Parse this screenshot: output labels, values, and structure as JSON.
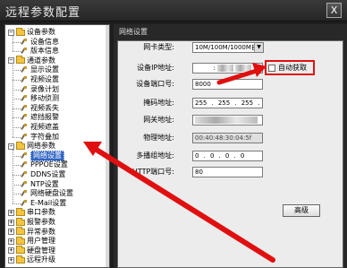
{
  "window": {
    "title": "远程参数配置",
    "close_label": "X"
  },
  "tree": [
    {
      "label": "设备参数",
      "type": "group",
      "expanded": true
    },
    {
      "label": "设备信息",
      "type": "leaf"
    },
    {
      "label": "版本信息",
      "type": "leaf"
    },
    {
      "label": "通道参数",
      "type": "group",
      "expanded": true
    },
    {
      "label": "显示设置",
      "type": "leaf"
    },
    {
      "label": "视频设置",
      "type": "leaf"
    },
    {
      "label": "录像计划",
      "type": "leaf"
    },
    {
      "label": "移动侦测",
      "type": "leaf"
    },
    {
      "label": "视频丢失",
      "type": "leaf"
    },
    {
      "label": "遮挡报警",
      "type": "leaf"
    },
    {
      "label": "视频遮盖",
      "type": "leaf"
    },
    {
      "label": "字符叠加",
      "type": "leaf"
    },
    {
      "label": "网络参数",
      "type": "group",
      "expanded": true
    },
    {
      "label": "网络设置",
      "type": "leaf",
      "selected": true
    },
    {
      "label": "PPPOE设置",
      "type": "leaf"
    },
    {
      "label": "DDNS设置",
      "type": "leaf"
    },
    {
      "label": "NTP设置",
      "type": "leaf"
    },
    {
      "label": "网络硬盘设置",
      "type": "leaf"
    },
    {
      "label": "E-Mail设置",
      "type": "leaf"
    },
    {
      "label": "串口参数",
      "type": "group",
      "expanded": false
    },
    {
      "label": "报警参数",
      "type": "group",
      "expanded": false
    },
    {
      "label": "异常参数",
      "type": "group",
      "expanded": false
    },
    {
      "label": "用户管理",
      "type": "group",
      "expanded": false
    },
    {
      "label": "硬盘管理",
      "type": "group",
      "expanded": false
    },
    {
      "label": "远程升级",
      "type": "group",
      "expanded": false
    }
  ],
  "network": {
    "header": "网络设置",
    "nic_type_label": "网卡类型:",
    "nic_type_value": "10M/100M/1000M自适",
    "ip_label": "设备IP地址:",
    "ip_value": ":",
    "dhcp_label": "自动获取",
    "port_label": "设备端口号:",
    "port_value": "8000",
    "mask_label": "掩码地址:",
    "mask_value": [
      "255",
      "255",
      "255",
      "0"
    ],
    "gateway_label": "网关地址:",
    "mac_label": "物理地址:",
    "mac_value": "00:40:48:30:04:5f",
    "multicast_label": "多播组地址:",
    "multicast_value": [
      "0",
      "0",
      "0",
      "0"
    ],
    "http_label": "HTTP端口号:",
    "http_value": "80",
    "advanced_button": "高级"
  },
  "colors": {
    "annotation_red": "#e01010",
    "selection_blue": "#3165c3"
  }
}
